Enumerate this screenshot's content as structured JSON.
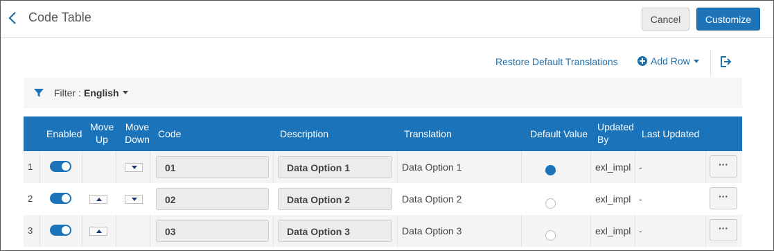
{
  "header": {
    "title": "Code Table",
    "cancel_label": "Cancel",
    "customize_label": "Customize"
  },
  "toolbar": {
    "restore_label": "Restore Default Translations",
    "add_row_label": "Add Row"
  },
  "filter": {
    "label": "Filter :",
    "value": "English"
  },
  "table": {
    "headers": {
      "enabled": "Enabled",
      "move_up_1": "Move",
      "move_up_2": "Up",
      "move_down_1": "Move",
      "move_down_2": "Down",
      "code": "Code",
      "description": "Description",
      "translation": "Translation",
      "default_value": "Default Value",
      "updated_by_1": "Updated",
      "updated_by_2": "By",
      "last_updated": "Last Updated"
    },
    "rows": [
      {
        "num": "1",
        "enabled": true,
        "move_up": false,
        "move_down": true,
        "code": "01",
        "description": "Data Option 1",
        "translation": "Data Option 1",
        "default": true,
        "updated_by": "exl_impl",
        "last_updated": "-",
        "more": "···"
      },
      {
        "num": "2",
        "enabled": true,
        "move_up": true,
        "move_down": true,
        "code": "02",
        "description": "Data Option 2",
        "translation": "Data Option 2",
        "default": false,
        "updated_by": "exl_impl",
        "last_updated": "-",
        "more": "···"
      },
      {
        "num": "3",
        "enabled": true,
        "move_up": true,
        "move_down": false,
        "code": "03",
        "description": "Data Option 3",
        "translation": "Data Option 3",
        "default": false,
        "updated_by": "exl_impl",
        "last_updated": "-",
        "more": "···"
      }
    ]
  },
  "colors": {
    "primary": "#1b74ba",
    "link": "#1f6fa8"
  }
}
